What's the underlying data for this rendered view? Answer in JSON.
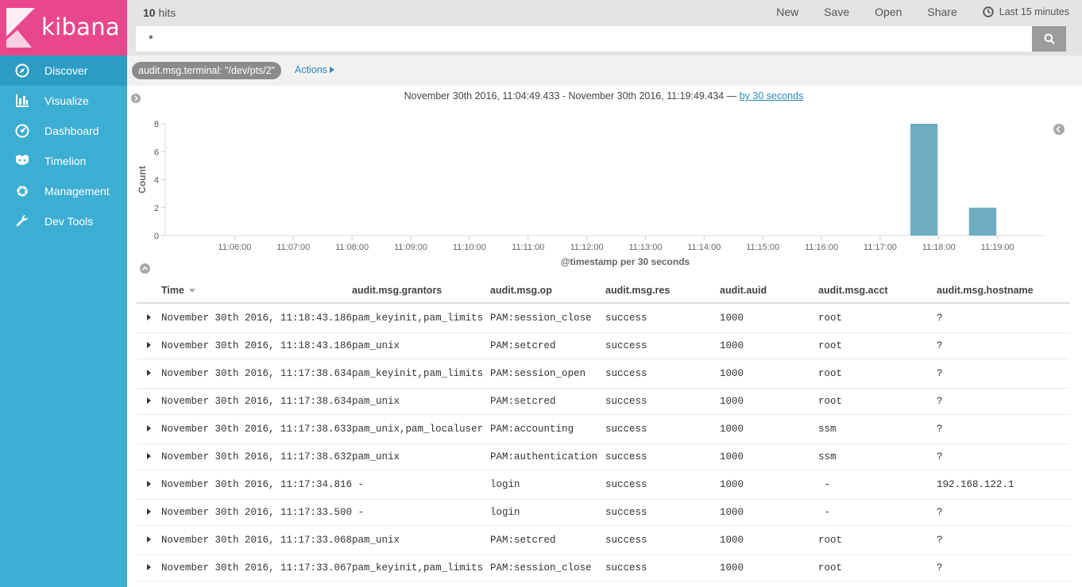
{
  "brand": {
    "name": "kibana"
  },
  "sidebar": {
    "items": [
      {
        "label": "Discover",
        "icon": "compass-icon",
        "active": true
      },
      {
        "label": "Visualize",
        "icon": "bar-chart-icon"
      },
      {
        "label": "Dashboard",
        "icon": "dashboard-icon"
      },
      {
        "label": "Timelion",
        "icon": "timelion-icon"
      },
      {
        "label": "Management",
        "icon": "gear-icon"
      },
      {
        "label": "Dev Tools",
        "icon": "wrench-icon"
      }
    ]
  },
  "header": {
    "hits_count": "10",
    "hits_label": "hits",
    "menu": {
      "new": "New",
      "save": "Save",
      "open": "Open",
      "share": "Share"
    },
    "timepicker_label": "Last 15 minutes"
  },
  "search": {
    "value": "*"
  },
  "filters": {
    "pill": "audit.msg.terminal: \"/dev/pts/2\"",
    "actions": "Actions"
  },
  "chart": {
    "range": "November 30th 2016, 11:04:49.433 - November 30th 2016, 11:19:49.434 —",
    "interval": "by 30 seconds"
  },
  "chart_data": {
    "type": "bar",
    "ylabel": "Count",
    "xlabel": "@timestamp per 30 seconds",
    "ylim": [
      0,
      8
    ],
    "yticks": [
      0,
      2,
      4,
      6,
      8
    ],
    "xlim": [
      "11:04:49",
      "11:19:49"
    ],
    "xticks": [
      "11:06:00",
      "11:07:00",
      "11:08:00",
      "11:09:00",
      "11:10:00",
      "11:11:00",
      "11:12:00",
      "11:13:00",
      "11:14:00",
      "11:15:00",
      "11:16:00",
      "11:17:00",
      "11:18:00",
      "11:19:00"
    ],
    "bars": [
      {
        "x": "11:17:30",
        "value": 8
      },
      {
        "x": "11:18:30",
        "value": 2
      }
    ],
    "bar_color": "#6eadc1"
  },
  "table": {
    "columns": [
      "Time",
      "audit.msg.grantors",
      "audit.msg.op",
      "audit.msg.res",
      "audit.auid",
      "audit.msg.acct",
      "audit.msg.hostname"
    ],
    "rows": [
      [
        "November 30th 2016, 11:18:43.186",
        "pam_keyinit,pam_limits",
        "PAM:session_close",
        "success",
        "1000",
        "root",
        "?"
      ],
      [
        "November 30th 2016, 11:18:43.186",
        "pam_unix",
        "PAM:setcred",
        "success",
        "1000",
        "root",
        "?"
      ],
      [
        "November 30th 2016, 11:17:38.634",
        "pam_keyinit,pam_limits",
        "PAM:session_open",
        "success",
        "1000",
        "root",
        "?"
      ],
      [
        "November 30th 2016, 11:17:38.634",
        "pam_unix",
        "PAM:setcred",
        "success",
        "1000",
        "root",
        "?"
      ],
      [
        "November 30th 2016, 11:17:38.633",
        "pam_unix,pam_localuser",
        "PAM:accounting",
        "success",
        "1000",
        "ssm",
        "?"
      ],
      [
        "November 30th 2016, 11:17:38.632",
        "pam_unix",
        "PAM:authentication",
        "success",
        "1000",
        "ssm",
        "?"
      ],
      [
        "November 30th 2016, 11:17:34.816",
        " -",
        "login",
        "success",
        "1000",
        " -",
        "192.168.122.1"
      ],
      [
        "November 30th 2016, 11:17:33.500",
        " -",
        "login",
        "success",
        "1000",
        " -",
        "?"
      ],
      [
        "November 30th 2016, 11:17:33.068",
        "pam_unix",
        "PAM:setcred",
        "success",
        "1000",
        "root",
        "?"
      ],
      [
        "November 30th 2016, 11:17:33.067",
        "pam_keyinit,pam_limits",
        "PAM:session_close",
        "success",
        "1000",
        "root",
        "?"
      ]
    ]
  }
}
